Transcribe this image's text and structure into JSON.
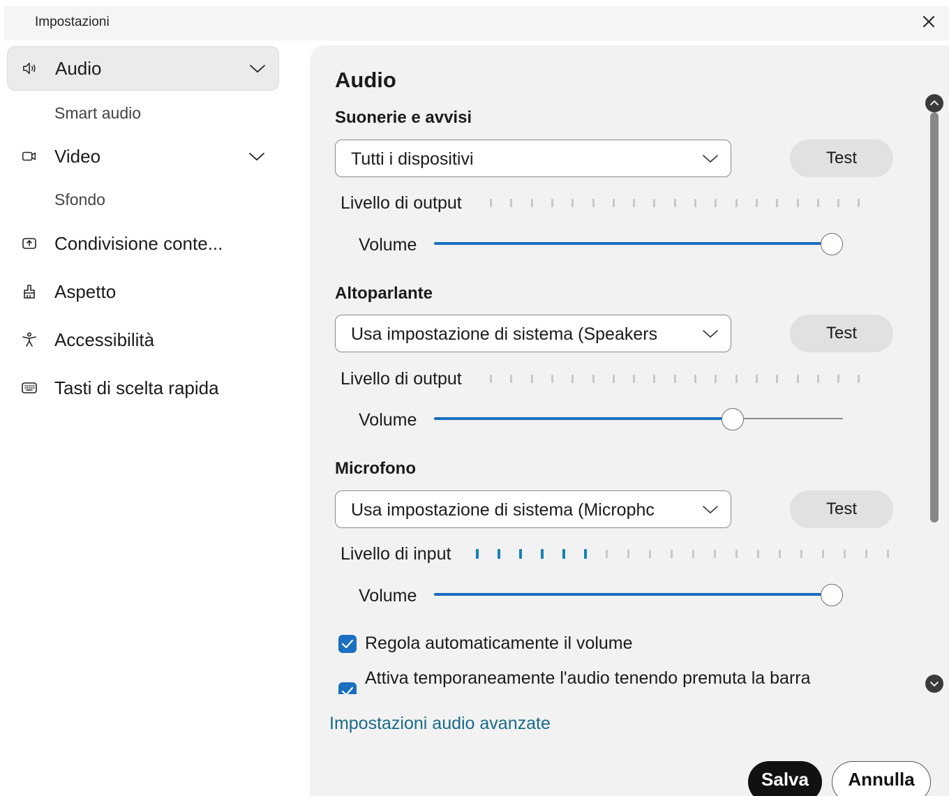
{
  "window": {
    "title": "Impostazioni",
    "close_icon": "close-icon"
  },
  "sidebar": {
    "items": [
      {
        "label": "Audio",
        "icon": "speaker-icon",
        "expanded": true
      },
      {
        "label": "Smart audio"
      },
      {
        "label": "Video",
        "icon": "camera-icon",
        "expanded": true
      },
      {
        "label": "Sfondo"
      },
      {
        "label": "Condivisione conte...",
        "icon": "share-screen-icon"
      },
      {
        "label": "Aspetto",
        "icon": "brush-icon"
      },
      {
        "label": "Accessibilità",
        "icon": "accessibility-icon"
      },
      {
        "label": "Tasti di scelta rapida",
        "icon": "keyboard-icon"
      }
    ]
  },
  "main": {
    "title": "Audio",
    "sections": [
      {
        "title": "Suonerie e avvisi",
        "device": "Tutti i dispositivi",
        "test_label": "Test",
        "level_label": "Livello di output",
        "level_active": 0,
        "volume_label": "Volume",
        "volume": 1.0
      },
      {
        "title": "Altoparlante",
        "device": "Usa impostazione di sistema (Speakers",
        "test_label": "Test",
        "level_label": "Livello di output",
        "level_active": 0,
        "volume_label": "Volume",
        "volume": 0.75
      },
      {
        "title": "Microfono",
        "device": "Usa impostazione di sistema (Microphc",
        "test_label": "Test",
        "level_label": "Livello di input",
        "level_active": 6,
        "volume_label": "Volume",
        "volume": 1.0
      }
    ],
    "checkboxes": [
      {
        "label": "Regola automaticamente il volume",
        "checked": true
      },
      {
        "label": "Attiva temporaneamente l'audio tenendo premuta la barra",
        "checked": true
      }
    ],
    "advanced_link": "Impostazioni audio avanzate"
  },
  "footer": {
    "save_label": "Salva",
    "cancel_label": "Annulla"
  },
  "colors": {
    "accent": "#1a6fc1",
    "level_on": "#1582b8",
    "link": "#1a6b8a",
    "primary_button": "#111111"
  }
}
